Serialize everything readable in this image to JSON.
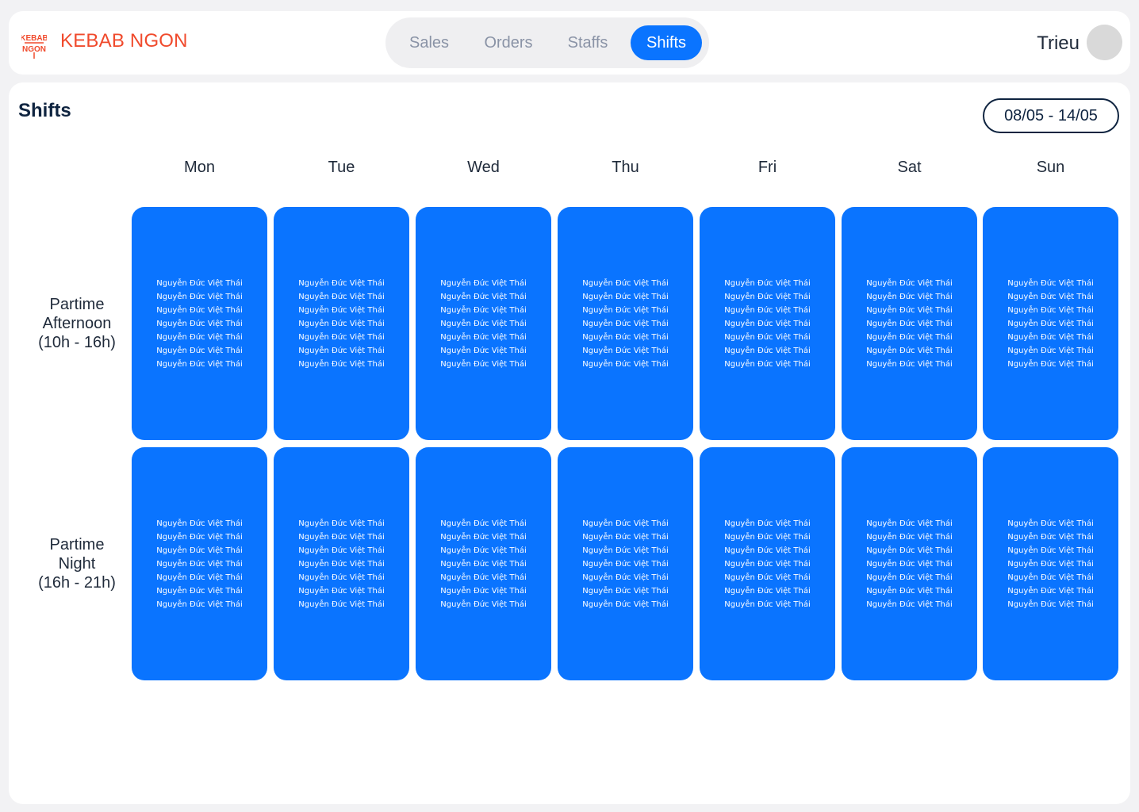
{
  "header": {
    "brand": "KEBAB NGON",
    "logo_text_top": "KEBAB",
    "logo_text_bottom": "NGON",
    "tabs": [
      {
        "label": "Sales",
        "active": false
      },
      {
        "label": "Orders",
        "active": false
      },
      {
        "label": "Staffs",
        "active": false
      },
      {
        "label": "Shifts",
        "active": true
      }
    ],
    "user_name": "Trieu"
  },
  "page": {
    "title": "Shifts",
    "date_range": "08/05 - 14/05"
  },
  "days": [
    "Mon",
    "Tue",
    "Wed",
    "Thu",
    "Fri",
    "Sat",
    "Sun"
  ],
  "shifts": [
    {
      "lines": [
        "Partime",
        "Afternoon",
        "(10h - 16h)"
      ]
    },
    {
      "lines": [
        "Partime",
        "Night",
        "(16h - 21h)"
      ]
    }
  ],
  "staff_names": [
    "Nguyễn Đức Việt Thái",
    "Nguyễn Đức Việt Thái",
    "Nguyễn Đức Việt Thái",
    "Nguyễn Đức Việt Thái",
    "Nguyễn Đức Việt Thái",
    "Nguyễn Đức Việt Thái",
    "Nguyễn Đức Việt Thái"
  ],
  "colors": {
    "brand": "#f04a2c",
    "accent": "#0a74ff",
    "text_dark": "#0f2440"
  },
  "icons": {
    "logo": "kebab-logo-icon",
    "avatar": "user-avatar"
  }
}
